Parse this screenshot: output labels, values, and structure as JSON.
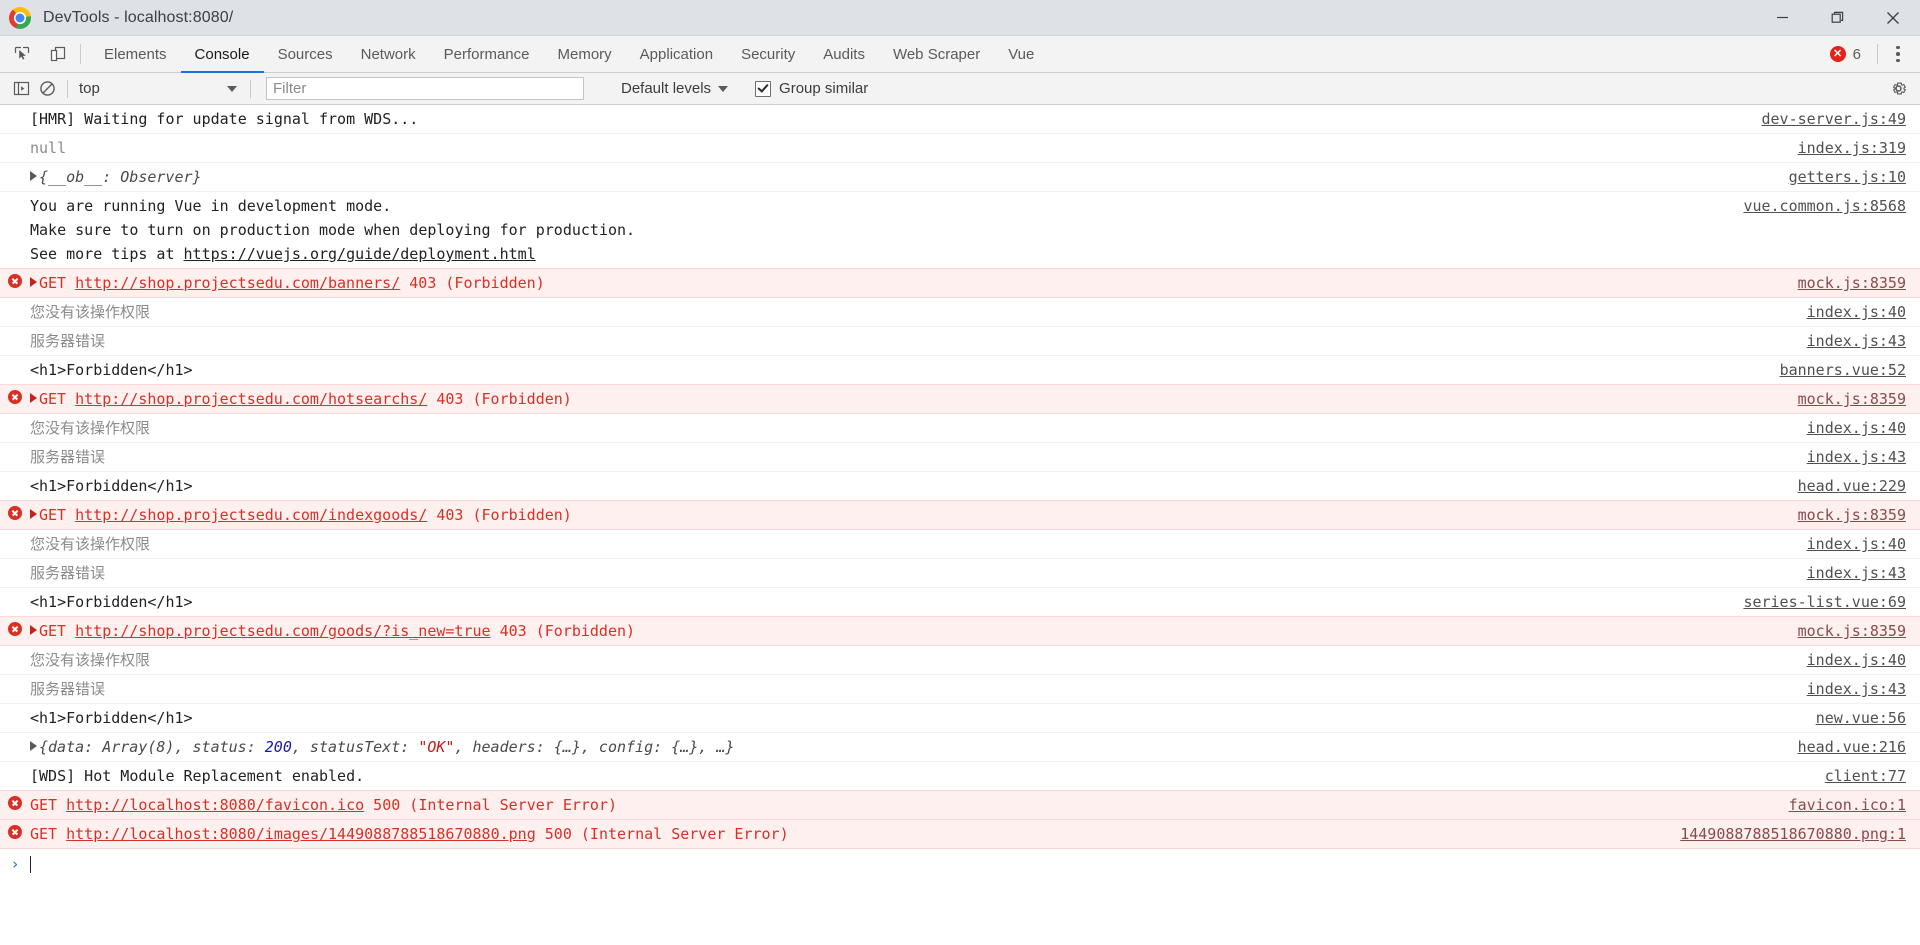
{
  "window": {
    "title": "DevTools - localhost:8080/",
    "logo_icon": "chrome-logo-icon",
    "minimize_label": "Minimize",
    "maximize_label": "Restore",
    "close_label": "Close"
  },
  "toolbar": {
    "inspect_icon": "inspect-element-icon",
    "device_icon": "toggle-device-toolbar-icon",
    "tabs": [
      {
        "label": "Elements",
        "active": false
      },
      {
        "label": "Console",
        "active": true
      },
      {
        "label": "Sources",
        "active": false
      },
      {
        "label": "Network",
        "active": false
      },
      {
        "label": "Performance",
        "active": false
      },
      {
        "label": "Memory",
        "active": false
      },
      {
        "label": "Application",
        "active": false
      },
      {
        "label": "Security",
        "active": false
      },
      {
        "label": "Audits",
        "active": false
      },
      {
        "label": "Web Scraper",
        "active": false
      },
      {
        "label": "Vue",
        "active": false
      }
    ],
    "error_badge": {
      "glyph": "✕",
      "count": "6"
    },
    "more_icon": "kebab-menu-icon"
  },
  "filterbar": {
    "sidebar_icon": "show-console-sidebar-icon",
    "clear_icon": "clear-console-icon",
    "context": "top",
    "filter_placeholder": "Filter",
    "filter_value": "",
    "levels": "Default levels",
    "group_similar": "Group similar",
    "group_similar_checked": true,
    "settings_icon": "gear-icon"
  },
  "console": {
    "rows": [
      {
        "kind": "log",
        "triangle": "none",
        "text": "[HMR] Waiting for update signal from WDS...",
        "style": "normal",
        "source": "dev-server.js:49"
      },
      {
        "kind": "log",
        "triangle": "none",
        "text": "null",
        "style": "dim",
        "source": "index.js:319"
      },
      {
        "kind": "log",
        "triangle": "gray",
        "text": "{__ob__: Observer}",
        "style": "italic",
        "source": "getters.js:10"
      },
      {
        "kind": "log",
        "triangle": "none",
        "text": "You are running Vue in development mode.\nMake sure to turn on production mode when deploying for production.\nSee more tips at https://vuejs.org/guide/deployment.html",
        "style": "normal",
        "link_part": "https://vuejs.org/guide/deployment.html",
        "source": "vue.common.js:8568"
      },
      {
        "kind": "error",
        "triangle": "red",
        "method": "GET",
        "url": "http://shop.projectsedu.com/banners/",
        "status": "403 (Forbidden)",
        "source": "mock.js:8359"
      },
      {
        "kind": "log",
        "triangle": "none",
        "text": "您没有该操作权限",
        "style": "dim",
        "source": "index.js:40"
      },
      {
        "kind": "log",
        "triangle": "none",
        "text": "服务器错误",
        "style": "dim",
        "source": "index.js:43"
      },
      {
        "kind": "log",
        "triangle": "none",
        "text": "<h1>Forbidden</h1>",
        "style": "normal",
        "source": "banners.vue:52"
      },
      {
        "kind": "error",
        "triangle": "red",
        "method": "GET",
        "url": "http://shop.projectsedu.com/hotsearchs/",
        "status": "403 (Forbidden)",
        "source": "mock.js:8359"
      },
      {
        "kind": "log",
        "triangle": "none",
        "text": "您没有该操作权限",
        "style": "dim",
        "source": "index.js:40"
      },
      {
        "kind": "log",
        "triangle": "none",
        "text": "服务器错误",
        "style": "dim",
        "source": "index.js:43"
      },
      {
        "kind": "log",
        "triangle": "none",
        "text": "<h1>Forbidden</h1>",
        "style": "normal",
        "source": "head.vue:229"
      },
      {
        "kind": "error",
        "triangle": "red",
        "method": "GET",
        "url": "http://shop.projectsedu.com/indexgoods/",
        "status": "403 (Forbidden)",
        "source": "mock.js:8359"
      },
      {
        "kind": "log",
        "triangle": "none",
        "text": "您没有该操作权限",
        "style": "dim",
        "source": "index.js:40"
      },
      {
        "kind": "log",
        "triangle": "none",
        "text": "服务器错误",
        "style": "dim",
        "source": "index.js:43"
      },
      {
        "kind": "log",
        "triangle": "none",
        "text": "<h1>Forbidden</h1>",
        "style": "normal",
        "source": "series-list.vue:69"
      },
      {
        "kind": "error",
        "triangle": "red",
        "method": "GET",
        "url": "http://shop.projectsedu.com/goods/?is_new=true",
        "status": "403 (Forbidden)",
        "source": "mock.js:8359"
      },
      {
        "kind": "log",
        "triangle": "none",
        "text": "您没有该操作权限",
        "style": "dim",
        "source": "index.js:40"
      },
      {
        "kind": "log",
        "triangle": "none",
        "text": "服务器错误",
        "style": "dim",
        "source": "index.js:43"
      },
      {
        "kind": "log",
        "triangle": "none",
        "text": "<h1>Forbidden</h1>",
        "style": "normal",
        "source": "new.vue:56"
      },
      {
        "kind": "object",
        "triangle": "gray",
        "preview": "{data: Array(8), status: 200, statusText: \"OK\", headers: {…}, config: {…}, …}",
        "source": "head.vue:216"
      },
      {
        "kind": "log",
        "triangle": "none",
        "text": "[WDS] Hot Module Replacement enabled.",
        "style": "normal",
        "source": "client:77"
      },
      {
        "kind": "error",
        "triangle": "none",
        "method": "GET",
        "url": "http://localhost:8080/favicon.ico",
        "status": "500 (Internal Server Error)",
        "source": "favicon.ico:1"
      },
      {
        "kind": "error",
        "triangle": "none",
        "method": "GET",
        "url": "http://localhost:8080/images/1449088788518670880.png",
        "status": "500 (Internal Server Error)",
        "source": "1449088788518670880.png:1"
      }
    ],
    "prompt_caret": "›",
    "prompt_value": ""
  },
  "colors": {
    "accent": "#1a73e8",
    "error_red": "#d93025",
    "error_bg": "#fff0f0",
    "chrome_titlebar": "#dee1e6",
    "toolbar_bg": "#f3f3f3",
    "number_token": "#1a1aa6",
    "string_token": "#c41a16"
  }
}
